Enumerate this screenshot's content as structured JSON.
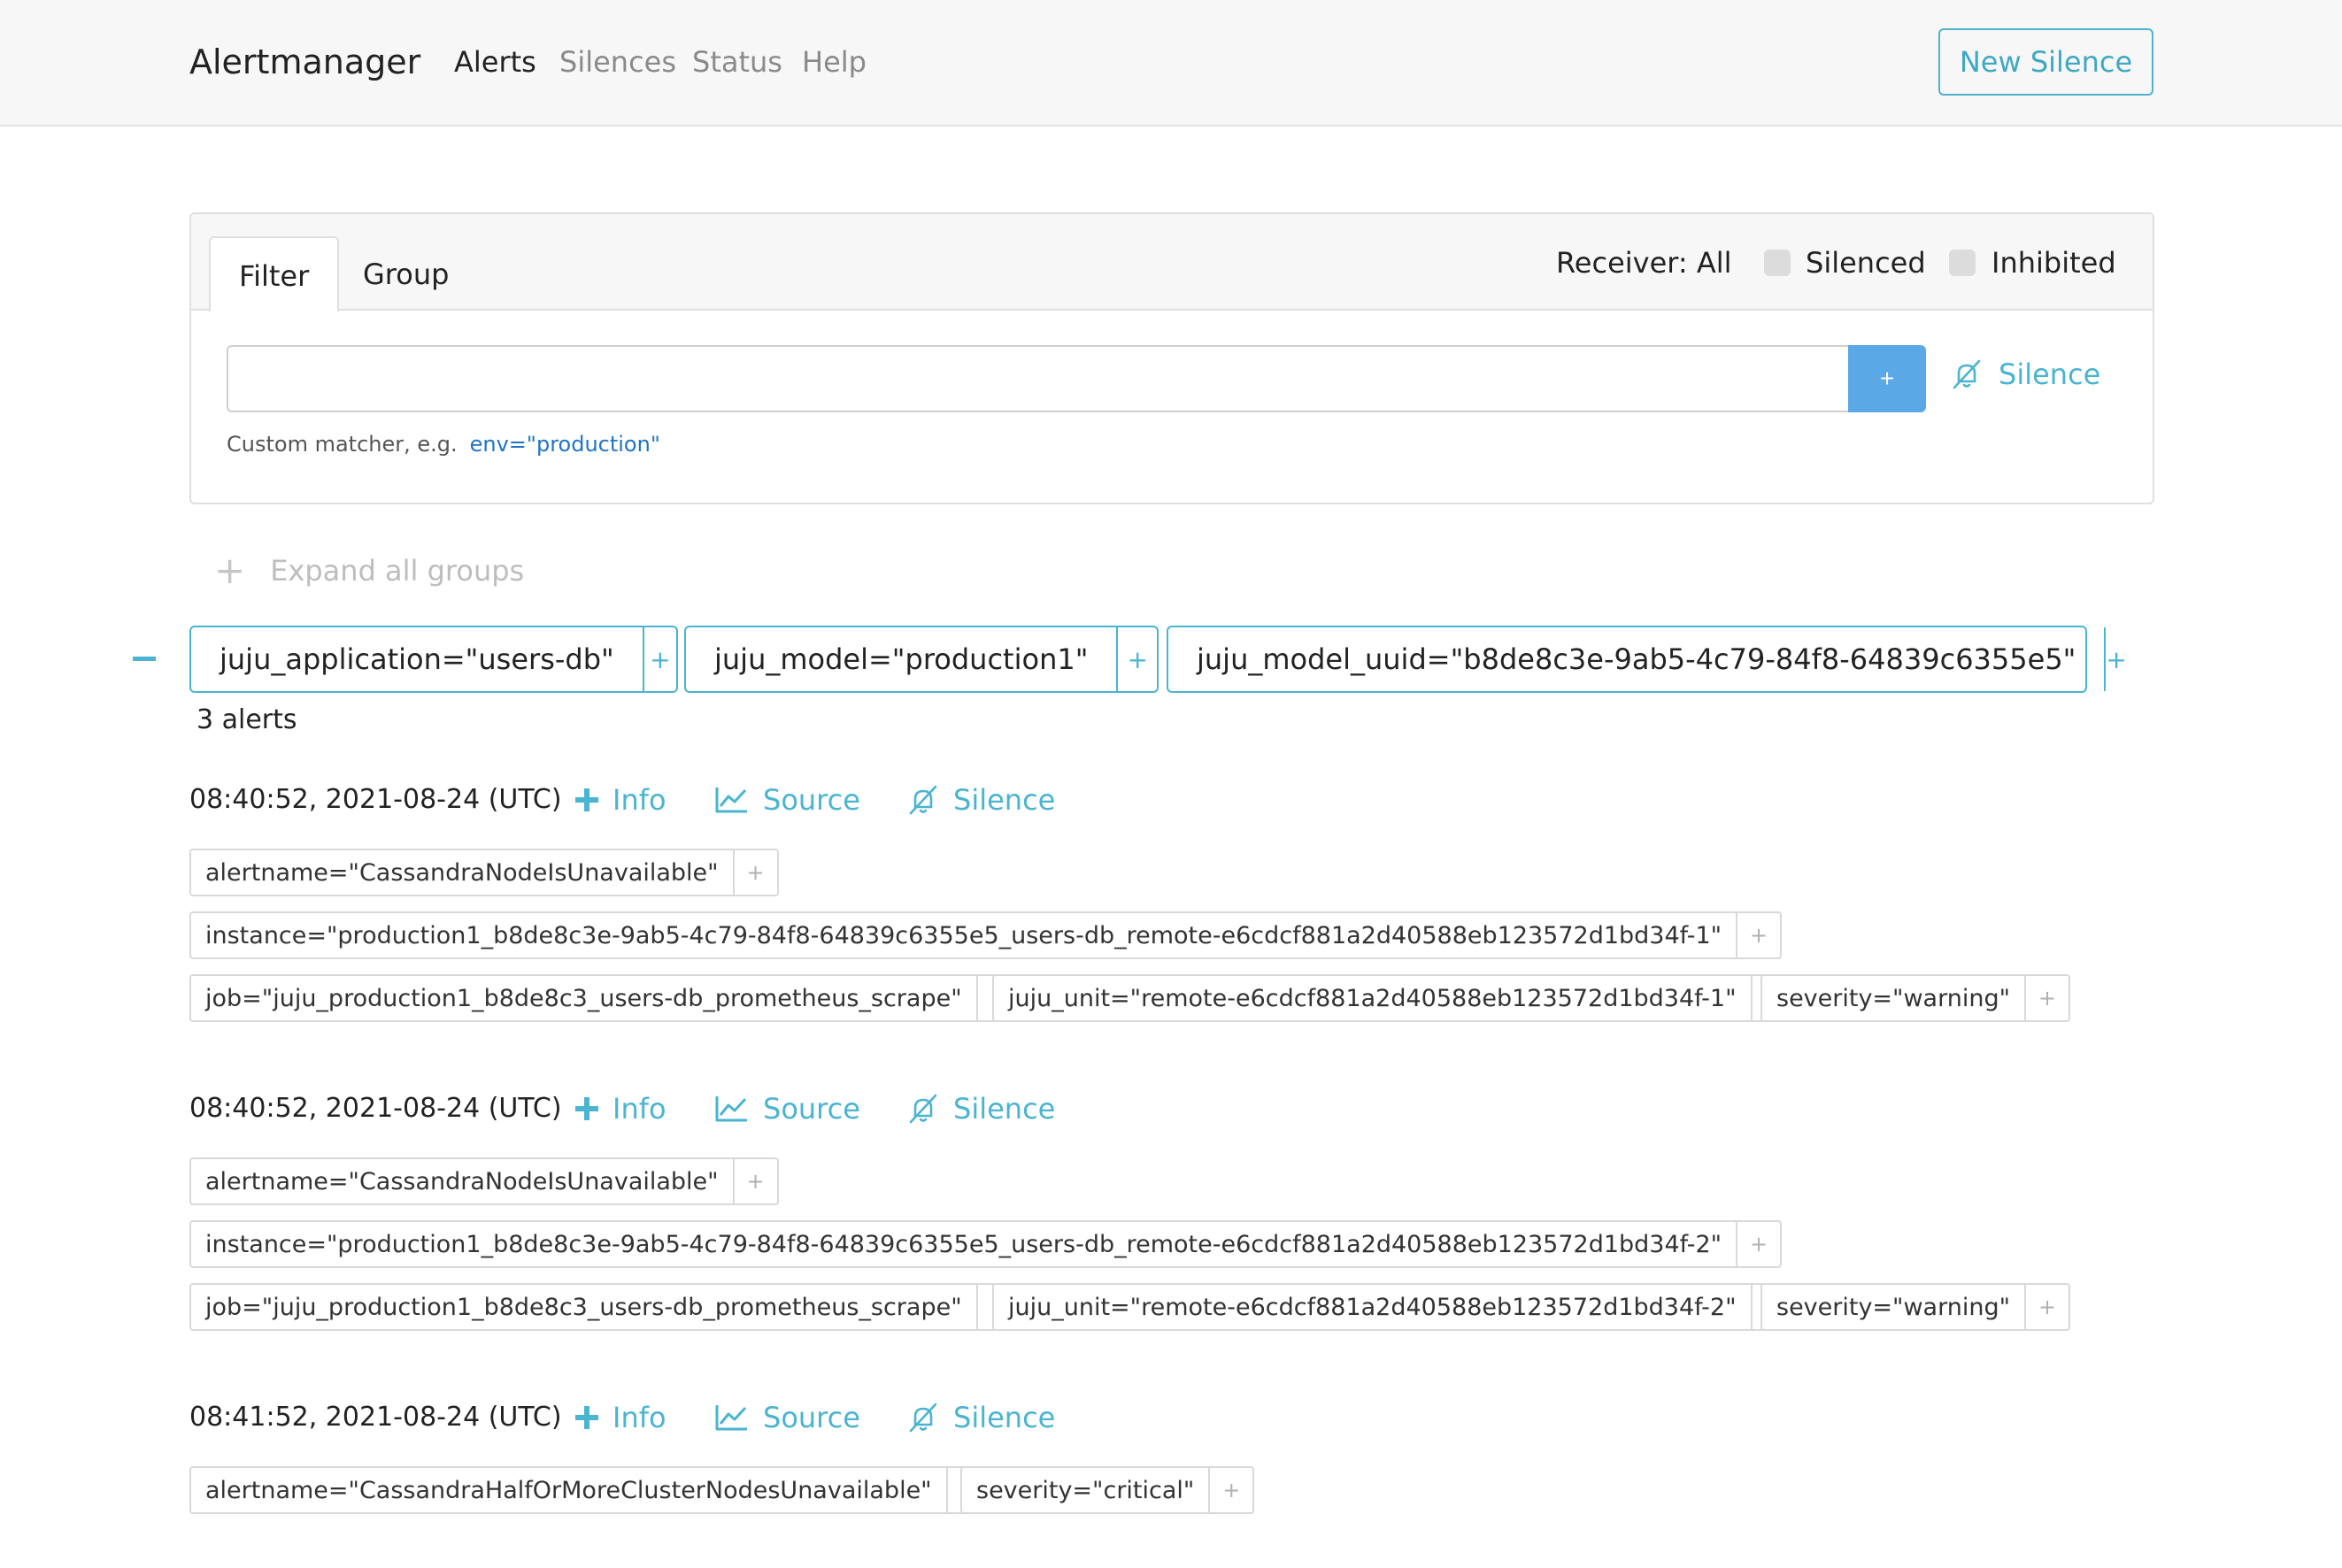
{
  "navbar": {
    "brand": "Alertmanager",
    "links": [
      "Alerts",
      "Silences",
      "Status",
      "Help"
    ],
    "new_silence": "New Silence"
  },
  "filter_card": {
    "tabs": [
      "Filter",
      "Group"
    ],
    "receiver": "Receiver: All",
    "silenced_label": "Silenced",
    "inhibited_label": "Inhibited",
    "input_value": "",
    "add_button": "+",
    "silence_label": "Silence",
    "hint_text": "Custom matcher, e.g.",
    "hint_example": "env=\"production\""
  },
  "expand_all": {
    "icon": "+",
    "label": "Expand all groups"
  },
  "group": {
    "labels": [
      "juju_application=\"users-db\"",
      "juju_model=\"production1\"",
      "juju_model_uuid=\"b8de8c3e-9ab5-4c79-84f8-64839c6355e5\""
    ],
    "add_symbol": "+",
    "count": "3 alerts"
  },
  "alert_actions": {
    "info": "Info",
    "source": "Source",
    "silence": "Silence"
  },
  "alerts": [
    {
      "time": "08:40:52, 2021-08-24 (UTC)",
      "labels": [
        "alertname=\"CassandraNodeIsUnavailable\"",
        "instance=\"production1_b8de8c3e-9ab5-4c79-84f8-64839c6355e5_users-db_remote-e6cdcf881a2d40588eb123572d1bd34f-1\"",
        "job=\"juju_production1_b8de8c3_users-db_prometheus_scrape\"",
        "juju_unit=\"remote-e6cdcf881a2d40588eb123572d1bd34f-1\"",
        "severity=\"warning\""
      ]
    },
    {
      "time": "08:40:52, 2021-08-24 (UTC)",
      "labels": [
        "alertname=\"CassandraNodeIsUnavailable\"",
        "instance=\"production1_b8de8c3e-9ab5-4c79-84f8-64839c6355e5_users-db_remote-e6cdcf881a2d40588eb123572d1bd34f-2\"",
        "job=\"juju_production1_b8de8c3_users-db_prometheus_scrape\"",
        "juju_unit=\"remote-e6cdcf881a2d40588eb123572d1bd34f-2\"",
        "severity=\"warning\""
      ]
    },
    {
      "time": "08:41:52, 2021-08-24 (UTC)",
      "labels": [
        "alertname=\"CassandraHalfOrMoreClusterNodesUnavailable\"",
        "severity=\"critical\""
      ]
    }
  ],
  "colors": {
    "accent": "#4ab4d1",
    "button_blue": "#5ba8e6",
    "navbar_bg": "#f7f7f8",
    "link_example": "#1f74c6"
  }
}
